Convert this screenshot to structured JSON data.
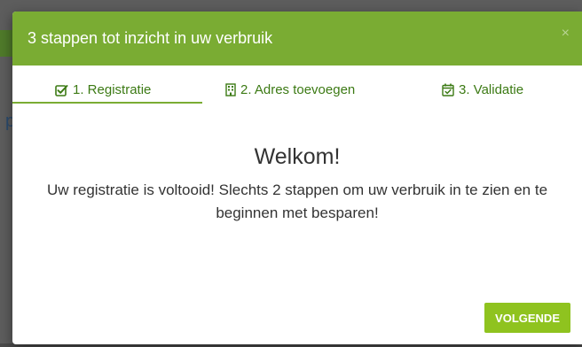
{
  "modal": {
    "title": "3 stappen tot inzicht in uw verbruik",
    "close_label": "×"
  },
  "steps": [
    {
      "label": "1. Registratie",
      "icon": "check-square-icon",
      "active": true
    },
    {
      "label": "2. Adres toevoegen",
      "icon": "building-icon",
      "active": false
    },
    {
      "label": "3. Validatie",
      "icon": "calendar-check-icon",
      "active": false
    }
  ],
  "content": {
    "heading": "Welkom!",
    "message": "Uw registratie is voltooid! Slechts 2 stappen om uw verbruik in te zien en te beginnen met besparen!"
  },
  "footer": {
    "next_label": "VOLGENDE"
  },
  "colors": {
    "header": "#7aac33",
    "step_text": "#3c7a14",
    "button": "#8fc31f",
    "backdrop": "#5d5d5d"
  }
}
